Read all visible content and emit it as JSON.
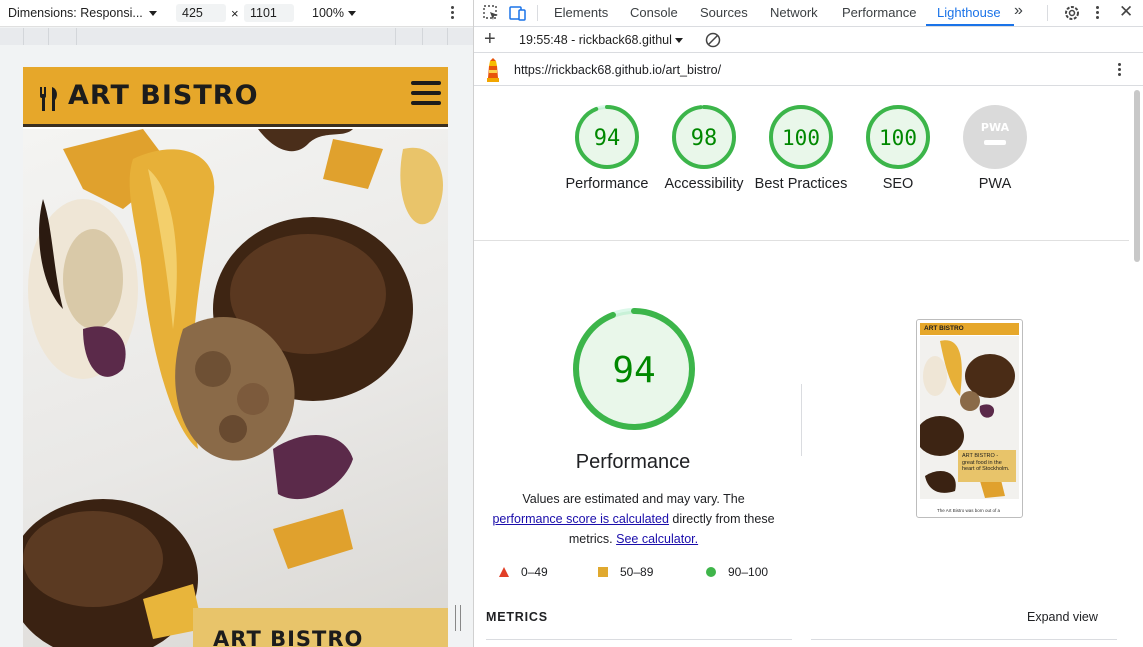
{
  "device_toolbar": {
    "dimensions_label": "Dimensions: Responsi...",
    "width": "425",
    "height": "1101",
    "times": "×",
    "zoom": "100%"
  },
  "site": {
    "title": "ART BISTRO",
    "caption": "ART BISTRO",
    "colors": {
      "header": "#e6a72a",
      "caption": "#e8c46a"
    }
  },
  "devtools": {
    "tabs": [
      {
        "label": "Elements"
      },
      {
        "label": "Console"
      },
      {
        "label": "Sources"
      },
      {
        "label": "Network"
      },
      {
        "label": "Performance"
      },
      {
        "label": "Lighthouse",
        "active": true
      }
    ],
    "accent": "#1a73e8"
  },
  "lighthouse": {
    "report_select": "19:55:48 - rickback68.githul",
    "url": "https://rickback68.github.io/art_bistro/",
    "gauges": [
      {
        "label": "Performance",
        "score": 94
      },
      {
        "label": "Accessibility",
        "score": 98
      },
      {
        "label": "Best Practices",
        "score": 100
      },
      {
        "label": "SEO",
        "score": 100
      },
      {
        "label": "PWA",
        "badge": "PWA"
      }
    ],
    "performance": {
      "score": "94",
      "title": "Performance",
      "desc_prefix": "Values are estimated and may vary. The ",
      "desc_link1": "performance score is calculated",
      "desc_middle": " directly from these metrics. ",
      "desc_link2": "See calculator."
    },
    "legend": [
      {
        "range": "0–49",
        "shape": "triangle-icon",
        "color": "#e13f27"
      },
      {
        "range": "50–89",
        "shape": "square-icon",
        "color": "#e0a92f"
      },
      {
        "range": "90–100",
        "shape": "circle-icon",
        "color": "#3fb54a"
      }
    ],
    "thumbnail": {
      "header": "ART BISTRO",
      "caption": "ART BISTRO - great food in the heart of Stockholm.",
      "footer": "The Art Bistro was born out of a"
    },
    "metrics_header": "METRICS",
    "expand_view": "Expand view",
    "colors": {
      "pass": "#0cce6b",
      "pass_text": "#008800",
      "pass_fill": "#e9f7ea",
      "pwa": "#dadada"
    }
  }
}
